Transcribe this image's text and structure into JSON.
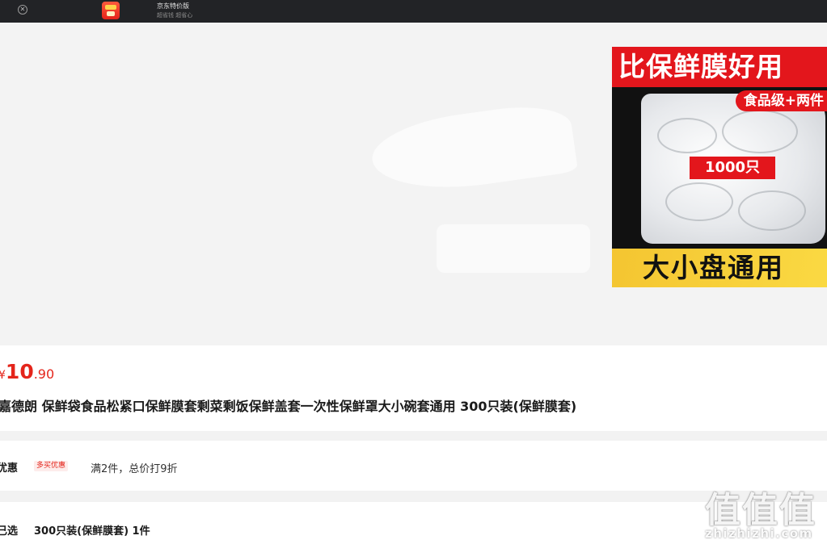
{
  "topbar": {
    "app_name": "京东特价版",
    "app_slogan": "超省钱 超省心",
    "close_glyph": "✕"
  },
  "hero": {
    "thumbnail": {
      "headline": "比保鲜膜好用",
      "tag": "食品级+两件",
      "count": "1000只",
      "footer": "大小盘通用"
    }
  },
  "product": {
    "price_symbol": "¥",
    "price_integer": "10",
    "price_decimal": ".90",
    "title": "嘉德朗 保鲜袋食品松紧口保鲜膜套剩菜剩饭保鲜盖套一次性保鲜罩大小碗套通用 300只装(保鲜膜套)"
  },
  "promotion": {
    "label": "优惠",
    "badge": "多买优惠",
    "text": "满2件，总价打9折"
  },
  "selection": {
    "label": "已选",
    "value": "300只装(保鲜膜套) 1件"
  },
  "watermark": {
    "logo": "值值值",
    "url": "zhizhizhi.com"
  },
  "colors": {
    "price_red": "#e4251b",
    "topbar_bg": "#222326",
    "thumb_red": "#e3161c",
    "thumb_yellow": "#f4c531"
  }
}
